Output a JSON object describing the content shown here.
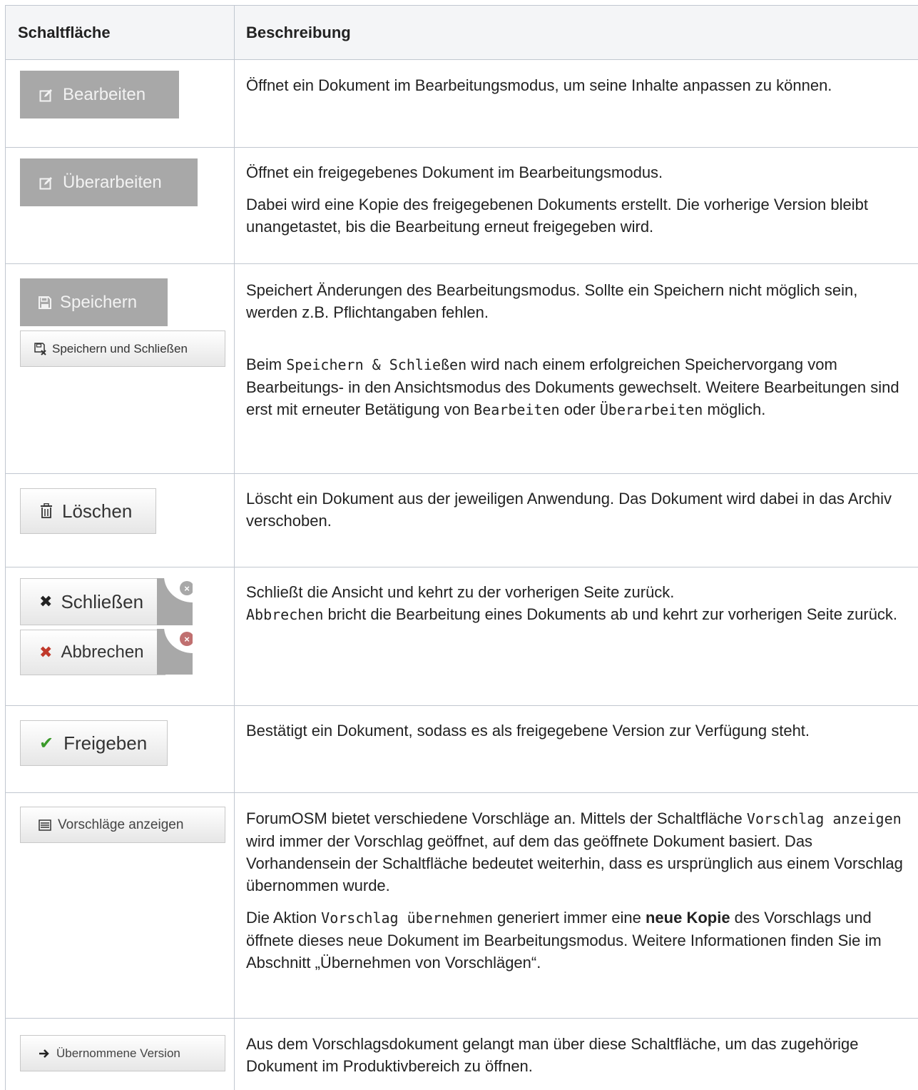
{
  "header": {
    "col1": "Schaltfläche",
    "col2": "Beschreibung"
  },
  "rows": [
    {
      "buttons": [
        "Bearbeiten"
      ],
      "desc": [
        "Öffnet ein Dokument im Bearbeitungsmodus, um seine Inhalte anpassen zu können."
      ]
    },
    {
      "buttons": [
        "Überarbeiten"
      ],
      "desc": [
        "Öffnet ein freigegebenes Dokument im Bearbeitungsmodus.",
        "Dabei wird eine Kopie des freigegebenen Dokuments erstellt. Die vorherige Version bleibt unangetastet, bis die Bearbeitung erneut freigegeben wird."
      ]
    },
    {
      "buttons": [
        "Speichern",
        "Speichern und Schließen"
      ],
      "desc": [
        "Speichert Änderungen des Bearbeitungsmodus. Sollte ein Speichern nicht möglich sein, werden z.B. Pflichtangaben fehlen."
      ],
      "desc2": {
        "t1": "Beim ",
        "c1": "Speichern & Schließen",
        "t2": " wird nach einem erfolgreichen Speichervorgang vom Bearbeitungs- in den Ansichtsmodus des Dokuments gewechselt. Weitere Bearbeitungen sind erst mit erneuter Betätigung von ",
        "c2": "Bearbeiten",
        "t3": " oder ",
        "c3": "Überarbeiten",
        "t4": " möglich."
      }
    },
    {
      "buttons": [
        "Löschen"
      ],
      "desc": [
        "Löscht ein Dokument aus der jeweiligen Anwendung. Das Dokument wird dabei in das Archiv verschoben."
      ]
    },
    {
      "buttons": [
        "Schließen",
        "Abbrechen"
      ],
      "desc": [
        "Schließt die Ansicht und kehrt zu der vorherigen Seite zurück."
      ],
      "desc2": {
        "c1": "Abbrechen",
        "t1": " bricht die Bearbeitung eines Dokuments ab und kehrt zur vorherigen Seite zurück."
      }
    },
    {
      "buttons": [
        "Freigeben"
      ],
      "desc": [
        "Bestätigt ein Dokument, sodass es als freigegebene Version zur Verfügung steht."
      ]
    },
    {
      "buttons": [
        "Vorschläge anzeigen"
      ],
      "desc2": {
        "t1": "ForumOSM bietet verschiedene Vorschläge an. Mittels der Schaltfläche ",
        "c1": "Vorschlag anzeigen",
        "t2": " wird immer der Vorschlag geöffnet, auf dem das geöffnete Dokument basiert. Das Vorhandensein der Schaltfläche bedeutet weiterhin, dass es ursprünglich aus einem Vorschlag übernommen wurde."
      },
      "desc3": {
        "t1": "Die Aktion ",
        "c1": "Vorschlag übernehmen",
        "t2": " generiert immer eine ",
        "b1": "neue Kopie",
        "t3": " des Vorschlags und öffnete dieses neue Dokument im Bearbeitungsmodus. Weitere Informationen finden Sie im Abschnitt „Übernehmen von Vorschlägen“."
      }
    },
    {
      "buttons": [
        "Übernommene Version"
      ],
      "desc": [
        "Aus dem Vorschlagsdokument gelangt man über diese Schaltfläche, um das zugehörige Dokument im Produktivbereich zu öffnen."
      ]
    }
  ],
  "colors": {
    "gray_button": "#a8a8a8",
    "header_bg": "#f4f5f7",
    "border": "#c1c7d0",
    "check_green": "#3a9a2a",
    "cancel_red": "#c0392b"
  }
}
